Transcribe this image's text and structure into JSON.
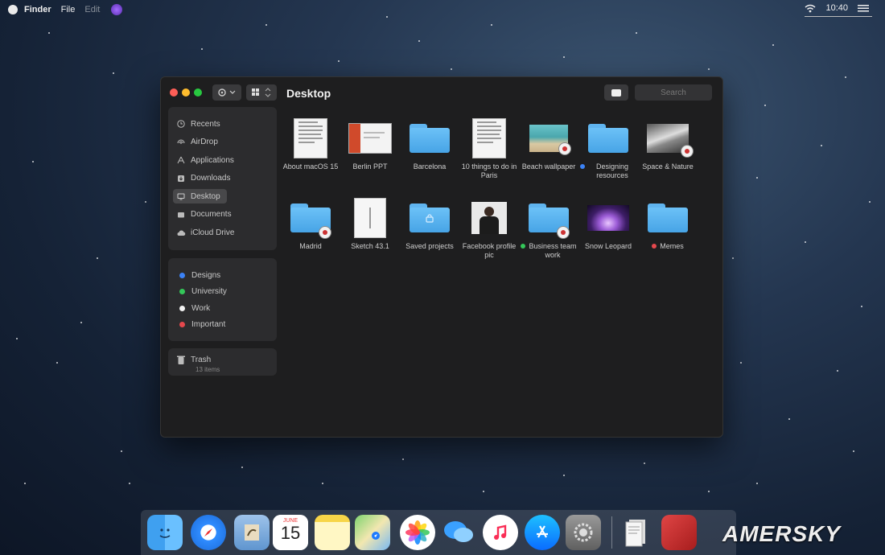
{
  "menubar": {
    "app": "Finder",
    "menus": [
      "File",
      "Edit"
    ],
    "clock": "10:40"
  },
  "window": {
    "title": "Desktop",
    "search_placeholder": "Search"
  },
  "sidebar": {
    "favorites": [
      {
        "label": "Recents",
        "icon": "clock-icon"
      },
      {
        "label": "AirDrop",
        "icon": "airdrop-icon"
      },
      {
        "label": "Applications",
        "icon": "applications-icon"
      },
      {
        "label": "Downloads",
        "icon": "downloads-icon"
      },
      {
        "label": "Desktop",
        "icon": "desktop-icon",
        "selected": true
      },
      {
        "label": "Documents",
        "icon": "documents-icon"
      },
      {
        "label": "iCloud Drive",
        "icon": "cloud-icon"
      }
    ],
    "tags": [
      {
        "label": "Designs",
        "color": "#3b82f6"
      },
      {
        "label": "University",
        "color": "#34c759"
      },
      {
        "label": "Work",
        "color": "#f2f2f2"
      },
      {
        "label": "Important",
        "color": "#e5484d"
      }
    ],
    "trash": {
      "label": "Trash",
      "count": "13 items"
    }
  },
  "files": [
    {
      "name": "About macOS 15",
      "kind": "doc",
      "tag": null
    },
    {
      "name": "Berlin PPT",
      "kind": "ppt",
      "tag": null
    },
    {
      "name": "Barcelona",
      "kind": "folder",
      "tag": null
    },
    {
      "name": "10 things to do in Paris",
      "kind": "doc",
      "tag": null
    },
    {
      "name": "Beach wallpaper",
      "kind": "image-beach",
      "tag": null
    },
    {
      "name": "Designing resources",
      "kind": "folder",
      "tag": "#3b82f6"
    },
    {
      "name": "Space & Nature",
      "kind": "image-space",
      "tag": null
    },
    {
      "name": "Madrid",
      "kind": "folder",
      "tag": null
    },
    {
      "name": "Sketch 43.1",
      "kind": "sketch",
      "tag": null
    },
    {
      "name": "Saved projects",
      "kind": "folder-shared",
      "tag": null
    },
    {
      "name": "Facebook profile pic",
      "kind": "image-person",
      "tag": null
    },
    {
      "name": "Business team work",
      "kind": "folder",
      "tag": "#34c759"
    },
    {
      "name": "Snow Leopard",
      "kind": "image-galaxy",
      "tag": null
    },
    {
      "name": "Memes",
      "kind": "folder",
      "tag": "#e5484d"
    }
  ],
  "dock": [
    {
      "name": "Finder",
      "icon": "finder-icon"
    },
    {
      "name": "Safari",
      "icon": "safari-icon"
    },
    {
      "name": "Preview",
      "icon": "preview-icon"
    },
    {
      "name": "Calendar",
      "icon": "calendar-icon",
      "month": "JUNE",
      "day": "15"
    },
    {
      "name": "Notes",
      "icon": "notes-icon"
    },
    {
      "name": "Maps",
      "icon": "maps-icon"
    },
    {
      "name": "Photos",
      "icon": "photos-icon"
    },
    {
      "name": "Messages",
      "icon": "messages-icon"
    },
    {
      "name": "iTunes",
      "icon": "music-icon"
    },
    {
      "name": "App Store",
      "icon": "app-store-icon"
    },
    {
      "name": "System Preferences",
      "icon": "system-preferences-icon"
    },
    {
      "name": "Documents",
      "icon": "document-stack-icon"
    },
    {
      "name": "Red app",
      "icon": "red-app-icon"
    }
  ],
  "watermark": "AMERSKY"
}
